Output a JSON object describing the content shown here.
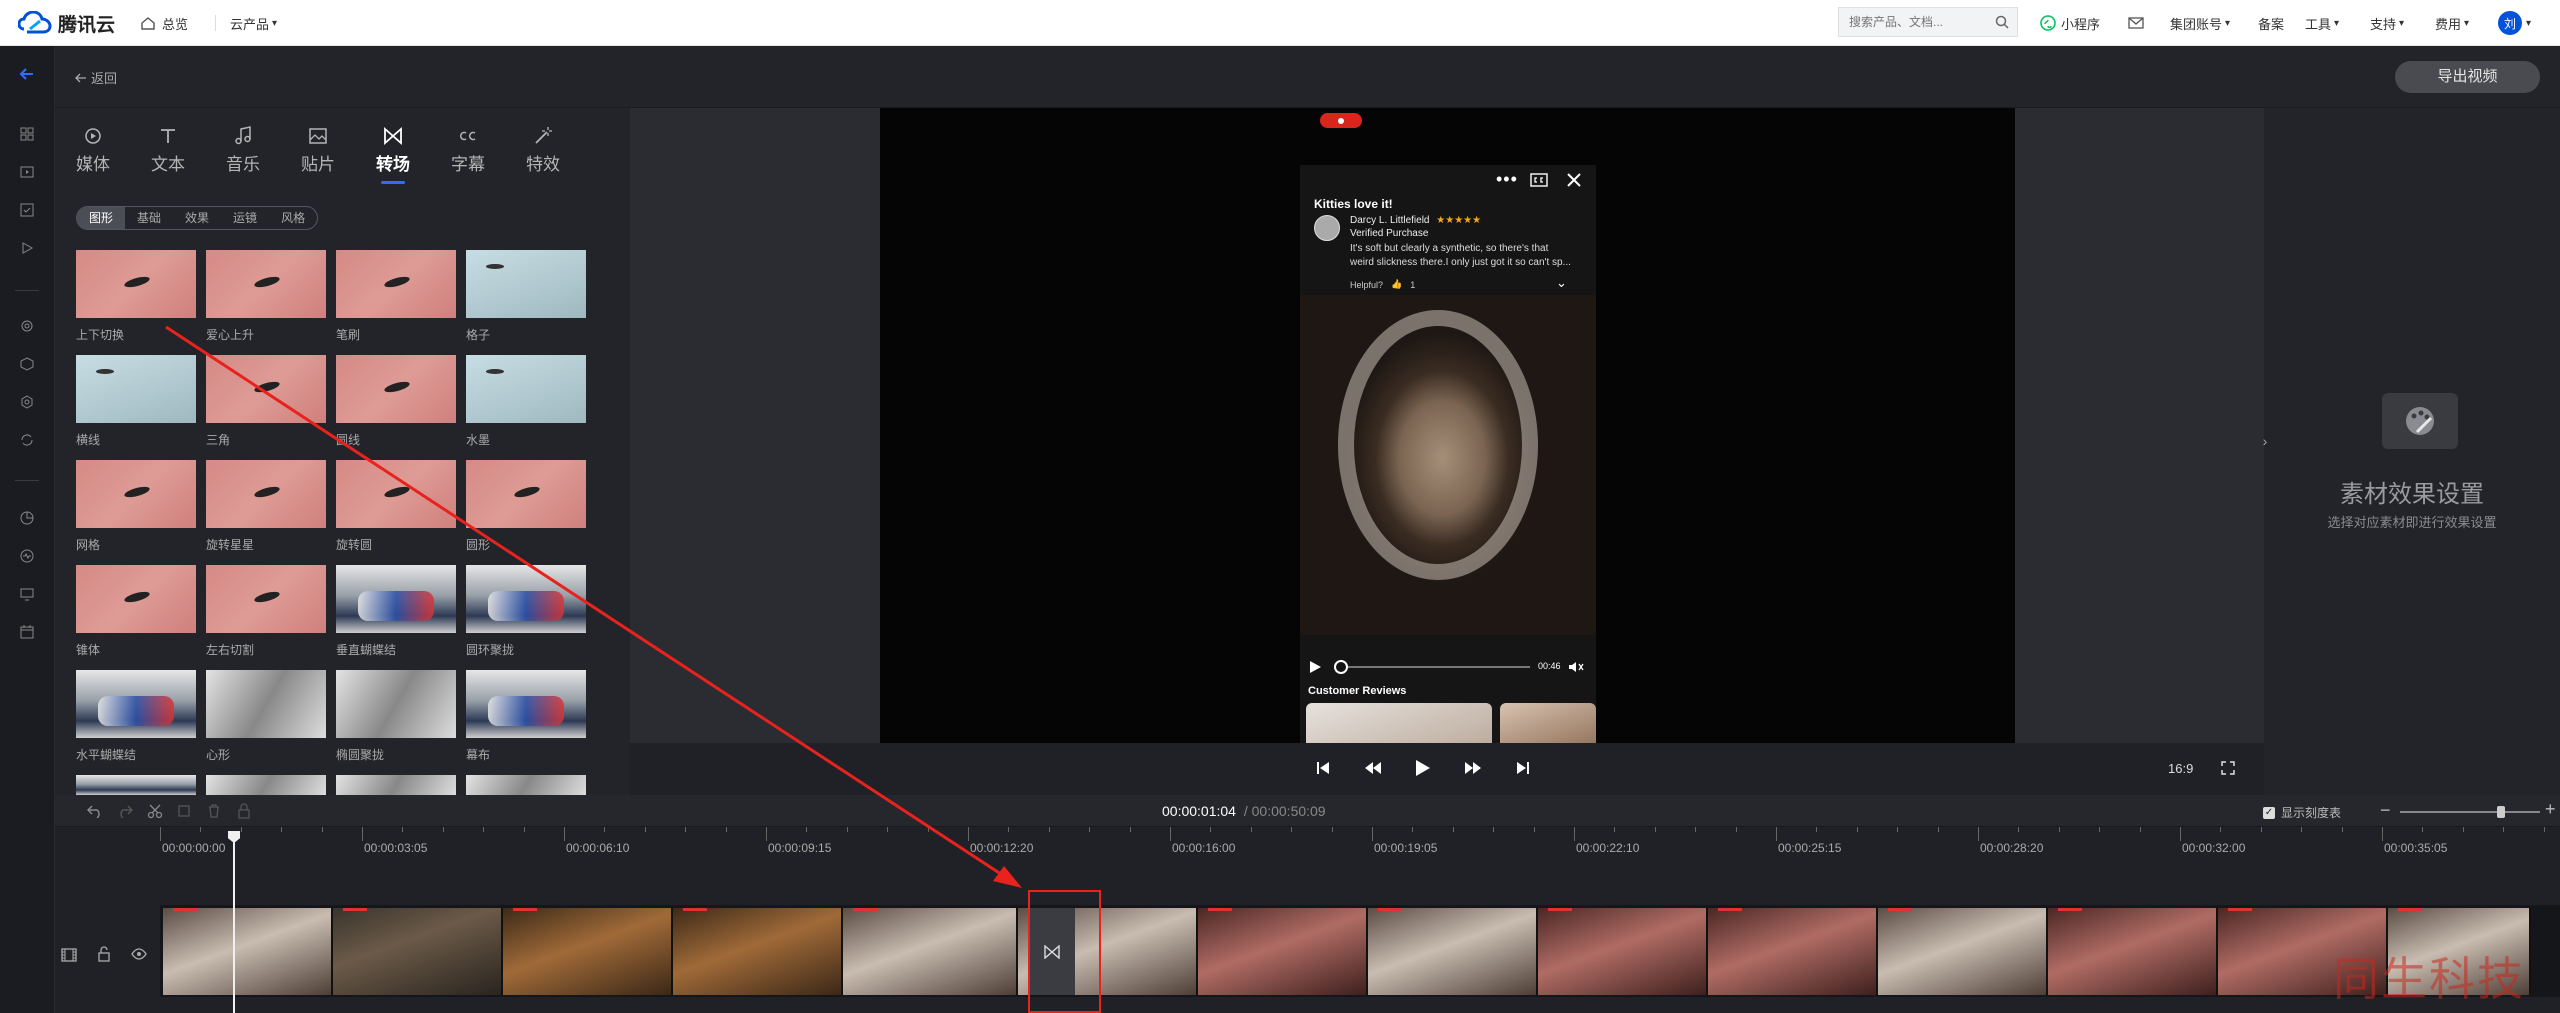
{
  "brand": {
    "name": "腾讯云",
    "blue": "#0052d9"
  },
  "nav": {
    "overview": "总览",
    "products": "云产品"
  },
  "search": {
    "placeholder": "搜索产品、文档..."
  },
  "toplinks": [
    "小程序",
    "集团账号",
    "备案",
    "工具",
    "支持",
    "费用"
  ],
  "user": {
    "avatar": "刘"
  },
  "header": {
    "back": "返回",
    "export": "导出视频"
  },
  "tabs": [
    {
      "label": "媒体",
      "icon": "media-icon"
    },
    {
      "label": "文本",
      "icon": "text-icon"
    },
    {
      "label": "音乐",
      "icon": "music-icon"
    },
    {
      "label": "贴片",
      "icon": "sticker-icon"
    },
    {
      "label": "转场",
      "icon": "transition-icon",
      "active": true
    },
    {
      "label": "字幕",
      "icon": "subtitle-icon"
    },
    {
      "label": "特效",
      "icon": "effects-icon"
    }
  ],
  "filters": [
    "图形",
    "基础",
    "效果",
    "运镜",
    "风格"
  ],
  "transitions": [
    "上下切换",
    "爱心上升",
    "笔刷",
    "格子",
    "横线",
    "三角",
    "圆线",
    "水墨",
    "网格",
    "旋转星星",
    "旋转圆",
    "圆形",
    "锥体",
    "左右切割",
    "垂直蝴蝶结",
    "圆环聚拢",
    "水平蝴蝶结",
    "心形",
    "椭圆聚拢",
    "幕布"
  ],
  "phone": {
    "review_title": "Kitties love it!",
    "reviewer": "Darcy L. Littlefield",
    "stars": "★★★★★",
    "verified": "Verified Purchase",
    "review_text_1": "It's soft but clearly a synthetic, so there's that",
    "review_text_2": "weird slickness there.I only just got it so can't sp...",
    "helpful": "Helpful?",
    "helpful_count": "1",
    "video_duration": "00:46",
    "customer_reviews": "Customer Reviews"
  },
  "aspect": "16:9",
  "right": {
    "title": "素材效果设置",
    "subtitle": "选择对应素材即进行效果设置"
  },
  "timeline": {
    "current": "00:00:01:04",
    "total": "/ 00:00:50:09",
    "show_scale": "显示刻度表",
    "ticks": [
      "00:00:00:00",
      "00:00:03:05",
      "00:00:06:10",
      "00:00:09:15",
      "00:00:12:20",
      "00:00:16:00",
      "00:00:19:05",
      "00:00:22:10",
      "00:00:25:15",
      "00:00:28:20",
      "00:00:32:00",
      "00:00:35:05"
    ],
    "zoom_level": 0.72
  },
  "watermark": "同生科技",
  "colors": {
    "accent": "#2b6fff",
    "annotation": "#e8221d"
  }
}
